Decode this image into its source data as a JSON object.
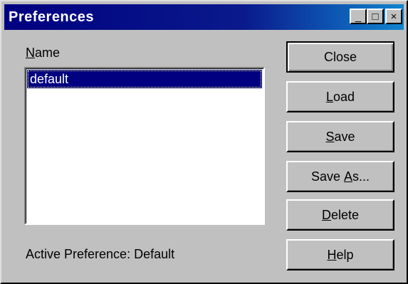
{
  "window": {
    "title": "Preferences",
    "minimize_glyph": "_",
    "maximize_glyph": "□",
    "close_glyph": "×"
  },
  "name_label": {
    "mnemonic": "N",
    "rest": "ame"
  },
  "list": {
    "items": [
      {
        "label": "default",
        "selected": true
      }
    ]
  },
  "status": "Active Preference: Default",
  "buttons": {
    "close": {
      "label": "Close"
    },
    "load": {
      "mnemonic": "L",
      "rest": "oad"
    },
    "save": {
      "mnemonic": "S",
      "rest": "ave"
    },
    "save_as": {
      "before": "Save ",
      "mnemonic": "A",
      "rest": "s..."
    },
    "delete": {
      "mnemonic": "D",
      "rest": "elete"
    },
    "help": {
      "mnemonic": "H",
      "rest": "elp"
    }
  },
  "colors": {
    "titlebar_start": "#000080",
    "titlebar_end": "#1084d0",
    "face": "#c0c0c0",
    "selection": "#000080"
  }
}
